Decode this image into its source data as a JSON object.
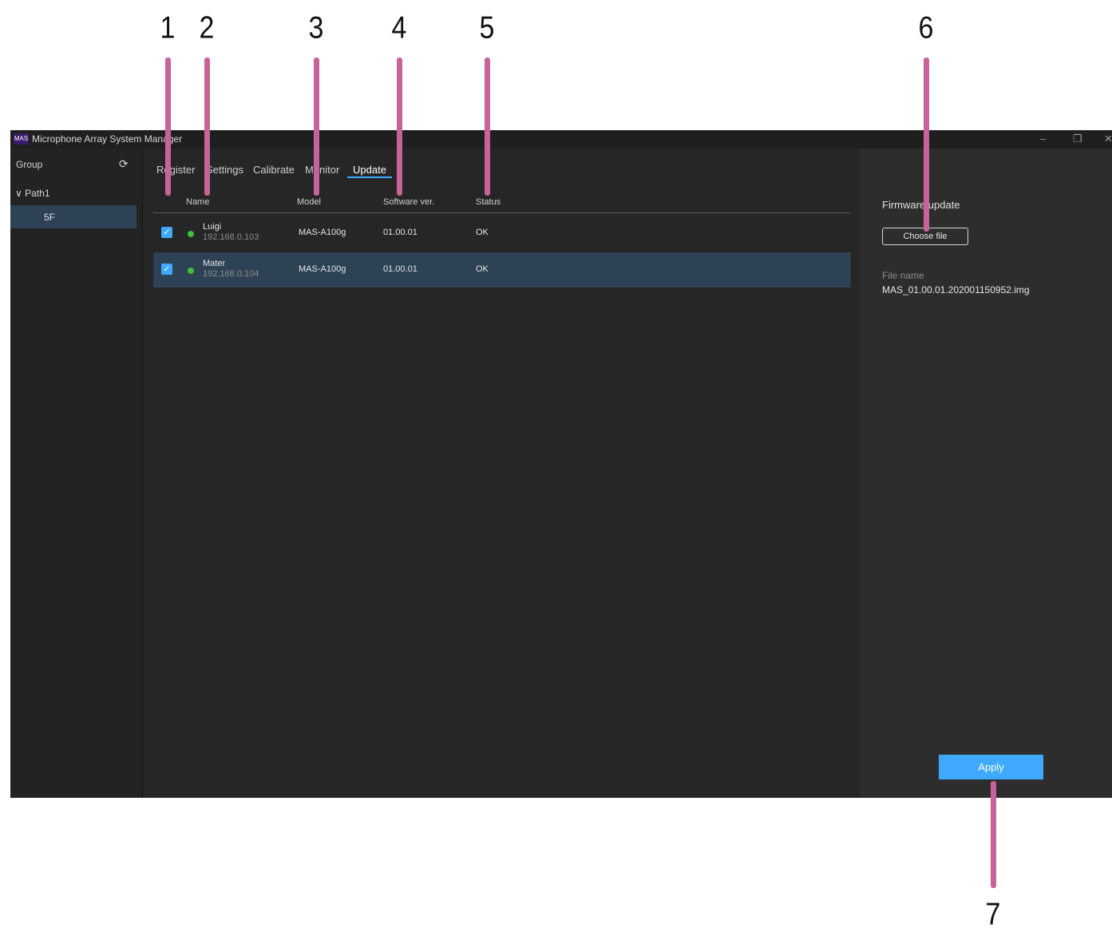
{
  "app": {
    "logo": "MAS",
    "title": "Microphone Array System Manager",
    "window_controls": {
      "minimize": "–",
      "restore": "❐",
      "close": "✕"
    }
  },
  "sidebar": {
    "group_label": "Group",
    "refresh_icon": "refresh-icon",
    "path": {
      "chevron": "∨",
      "label": "Path1"
    },
    "groups": [
      {
        "label": "5F",
        "selected": true
      }
    ]
  },
  "tabs": [
    {
      "label": "Register"
    },
    {
      "label": "Settings"
    },
    {
      "label": "Calibrate"
    },
    {
      "label": "Monitor"
    },
    {
      "label": "Update",
      "active": true
    }
  ],
  "table": {
    "headers": {
      "name": "Name",
      "model": "Model",
      "software": "Software ver.",
      "status": "Status"
    },
    "rows": [
      {
        "checked": true,
        "name": "Luigi",
        "ip": "192.168.0.103",
        "model": "MAS-A100g",
        "software": "01.00.01",
        "status": "OK",
        "online": true
      },
      {
        "checked": true,
        "name": "Mater",
        "ip": "192.168.0.104",
        "model": "MAS-A100g",
        "software": "01.00.01",
        "status": "OK",
        "online": true,
        "selected": true
      }
    ]
  },
  "firmware_panel": {
    "title": "Firmware update",
    "choose_label": "Choose file",
    "file_name_label": "File name",
    "file_name_value": "MAS_01.00.01.202001150952.img",
    "apply_label": "Apply"
  },
  "callouts": [
    "1",
    "2",
    "3",
    "4",
    "5",
    "6",
    "7"
  ],
  "colors": {
    "accent": "#3fa9ff",
    "callout": "#c8629a",
    "selected_row": "#2d4254",
    "status_online": "#3ec13e"
  }
}
